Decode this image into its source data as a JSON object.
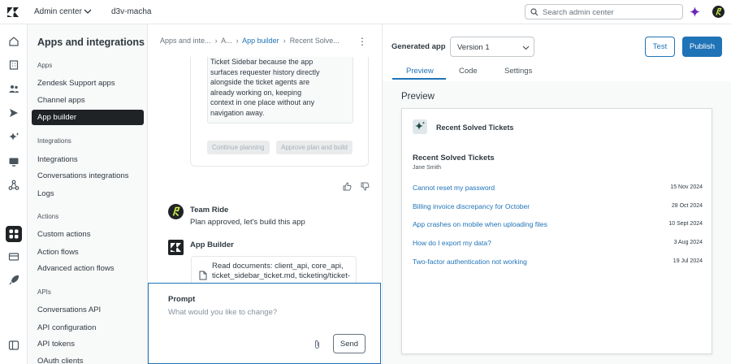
{
  "topbar": {
    "product": "Admin center",
    "account": "d3v-macha",
    "search_placeholder": "Search admin center"
  },
  "icons": {
    "logo": "zendesk-logo-icon",
    "rail": [
      "home-icon",
      "building-icon",
      "people-icon",
      "channels-icon",
      "ai-sparkle-icon",
      "workspaces-icon",
      "objects-icon",
      "apps-icon",
      "account-icon",
      "rocket-icon",
      "sidebar-collapse-icon"
    ]
  },
  "sidenav": {
    "title": "Apps and integrations",
    "sections": [
      {
        "label": "Apps",
        "items": [
          "Zendesk Support apps",
          "Channel apps",
          "App builder"
        ]
      },
      {
        "label": "Integrations",
        "items": [
          "Integrations",
          "Conversations integrations",
          "Logs"
        ]
      },
      {
        "label": "Actions",
        "items": [
          "Custom actions",
          "Action flows",
          "Advanced action flows"
        ]
      },
      {
        "label": "APIs",
        "items": [
          "Conversations API",
          "API configuration",
          "API tokens",
          "OAuth clients"
        ]
      }
    ],
    "active_item": "App builder"
  },
  "chat": {
    "breadcrumbs": [
      "Apps and inte...",
      "A...",
      "App builder",
      "Recent Solve..."
    ],
    "plan_text": [
      "Ticket Sidebar because the app",
      "surfaces requester history directly",
      "alongside the ticket agents are",
      "already working on, keeping",
      "context in one place without any",
      "navigation away."
    ],
    "continue_label": "Continue planning",
    "approve_label": "Approve plan and build",
    "messages": [
      {
        "name": "Team Ride",
        "text": "Plan approved, let's build this app"
      },
      {
        "name": "App Builder",
        "text": ""
      }
    ],
    "docs_text": "Read documents: client_api, core_api, ticket_sidebar_ticket.md, ticketing/ticket-",
    "prompt_label": "Prompt",
    "prompt_placeholder": "What would you like to change?",
    "send_label": "Send"
  },
  "preview_pane": {
    "generated_label": "Generated app",
    "version": "Version 1",
    "test_label": "Test",
    "publish_label": "Publish",
    "tabs": [
      "Preview",
      "Code",
      "Settings"
    ],
    "active_tab": "Preview",
    "title": "Preview",
    "app_name": "Recent Solved Tickets",
    "list_title": "Recent Solved Tickets",
    "requester": "Jane Smith",
    "tickets": [
      {
        "subject": "Cannot reset my password",
        "date": "15 Nov 2024"
      },
      {
        "subject": "Billing invoice discrepancy for October",
        "date": "28 Oct 2024"
      },
      {
        "subject": "App crashes on mobile when uploading files",
        "date": "10 Sept 2024"
      },
      {
        "subject": "How do I export my data?",
        "date": "3 Aug 2024"
      },
      {
        "subject": "Two-factor authentication not working",
        "date": "19 Jul 2024"
      }
    ]
  },
  "colors": {
    "accent": "#1f73b7",
    "dark": "#1f2326",
    "sidebar_bg": "#f8f9f9",
    "sparkle": "#6a27b8"
  }
}
